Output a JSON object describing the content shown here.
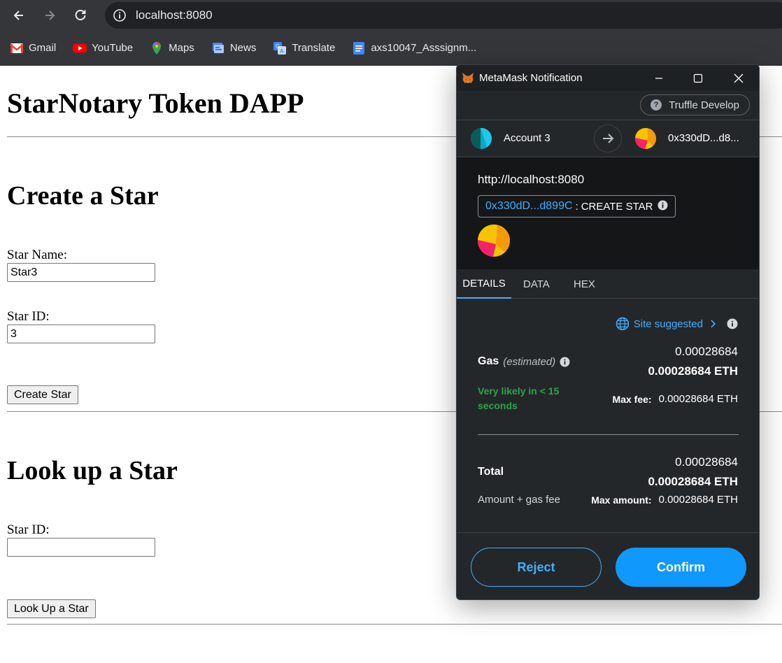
{
  "browser": {
    "url": "localhost:8080",
    "bookmarks": [
      {
        "label": "Gmail",
        "icon": "gmail-icon"
      },
      {
        "label": "YouTube",
        "icon": "youtube-icon"
      },
      {
        "label": "Maps",
        "icon": "maps-icon"
      },
      {
        "label": "News",
        "icon": "news-icon"
      },
      {
        "label": "Translate",
        "icon": "translate-icon"
      },
      {
        "label": "axs10047_Asssignm...",
        "icon": "docs-icon"
      }
    ]
  },
  "page": {
    "title": "StarNotary Token DAPP",
    "create": {
      "heading": "Create a Star",
      "name_label": "Star Name:",
      "name_value": "Star3",
      "id_label": "Star ID:",
      "id_value": "3",
      "button": "Create Star"
    },
    "lookup": {
      "heading": "Look up a Star",
      "id_label": "Star ID:",
      "id_value": "",
      "button": "Look Up a Star"
    }
  },
  "metamask": {
    "window_title": "MetaMask Notification",
    "network": "Truffle Develop",
    "from_account": "Account 3",
    "to_account": "0x330dD...d8...",
    "origin": "http://localhost:8080",
    "contract_address": "0x330dD...d899C",
    "method_separator": ":",
    "method": "CREATE STAR",
    "tabs": [
      "DETAILS",
      "DATA",
      "HEX"
    ],
    "active_tab": "DETAILS",
    "site_suggested": "Site suggested",
    "gas": {
      "label": "Gas",
      "estimated": "(estimated)",
      "value": "0.00028684",
      "value_eth": "0.00028684 ETH",
      "speed": "Very likely in < 15 seconds",
      "max_fee_label": "Max fee:",
      "max_fee": "0.00028684 ETH"
    },
    "total": {
      "label": "Total",
      "value": "0.00028684",
      "value_eth": "0.00028684 ETH",
      "sub_label": "Amount + gas fee",
      "max_amount_label": "Max amount:",
      "max_amount": "0.00028684 ETH"
    },
    "reject": "Reject",
    "confirm": "Confirm",
    "colors": {
      "accent": "#1098fc",
      "link": "#43aefc",
      "success": "#28a745",
      "background": "#24272a"
    }
  }
}
